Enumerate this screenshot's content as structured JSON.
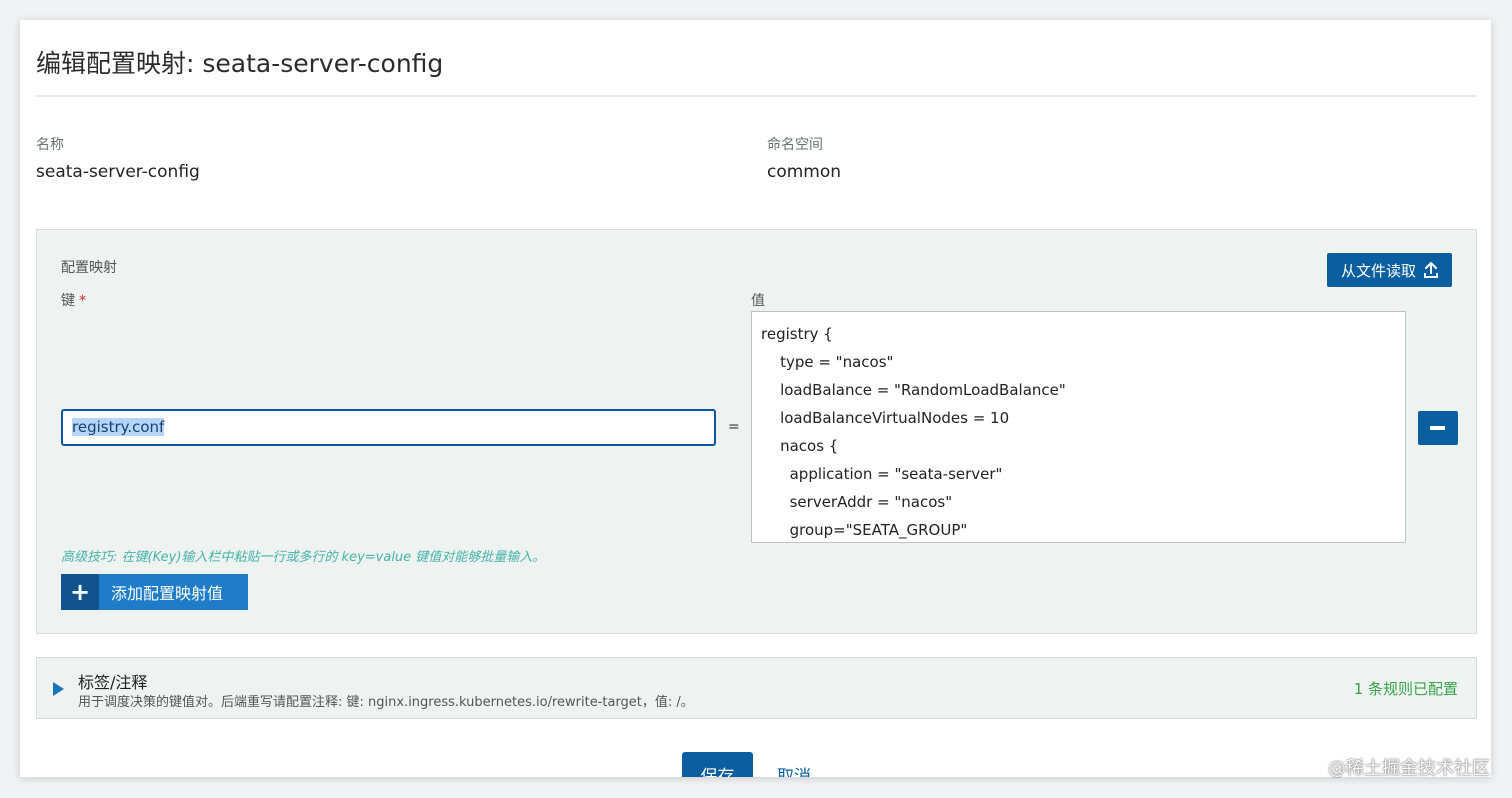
{
  "dialog": {
    "title": "编辑配置映射: seata-server-config"
  },
  "meta": {
    "name_label": "名称",
    "name_value": "seata-server-config",
    "namespace_label": "命名空间",
    "namespace_value": "common"
  },
  "configmap": {
    "section_title": "配置映射",
    "read_file_label": "从文件读取",
    "key_label": "键",
    "required_mark": "*",
    "value_label": "值",
    "key_value": "registry.conf",
    "equals": "=",
    "value_lines": [
      "registry {",
      "    type = \"nacos\"",
      "    loadBalance = \"RandomLoadBalance\"",
      "    loadBalanceVirtualNodes = 10",
      "    nacos {",
      "      application = \"seata-server\"",
      "      serverAddr = \"nacos\"",
      "      group=\"SEATA_GROUP\""
    ],
    "tip": "高级技巧: 在键(Key)输入栏中粘贴一行或多行的 key=value 键值对能够批量输入。",
    "add_label": "添加配置映射值",
    "add_icon": "+"
  },
  "labels": {
    "title": "标签/注释",
    "description": "用于调度决策的键值对。后端重写请配置注释: 键: nginx.ingress.kubernetes.io/rewrite-target，值: /。",
    "status": "1 条规则已配置"
  },
  "footer": {
    "save_label": "保存",
    "cancel_label": "取消"
  },
  "watermark": "@稀土掘金技术社区",
  "colors": {
    "primary": "#0b5fa1",
    "accent": "#1f7cc9",
    "success": "#3aa34a",
    "tip": "#44b3a8"
  }
}
